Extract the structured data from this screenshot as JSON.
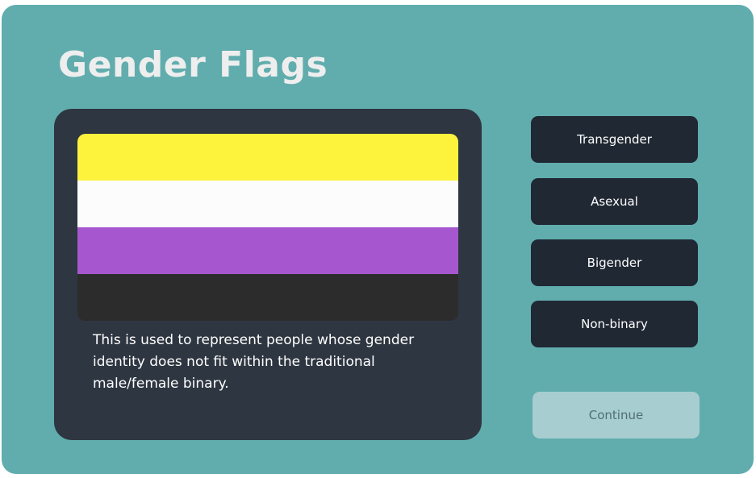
{
  "header": {
    "title": "Gender Flags"
  },
  "flag": {
    "name": "Non-binary",
    "stripes": [
      {
        "color": "#fdf33d"
      },
      {
        "color": "#fcfcfc"
      },
      {
        "color": "#a657cf"
      },
      {
        "color": "#2c2c2c"
      }
    ],
    "description": "This is used to represent people whose gender identity does not fit within the traditional male/female binary."
  },
  "options": [
    {
      "label": "Transgender"
    },
    {
      "label": "Asexual"
    },
    {
      "label": "Bigender"
    },
    {
      "label": "Non-binary"
    }
  ],
  "continue_label": "Continue",
  "colors": {
    "background": "#61adae",
    "card": "#2e3641",
    "option": "#202833",
    "continue": "#a7cdd0"
  }
}
